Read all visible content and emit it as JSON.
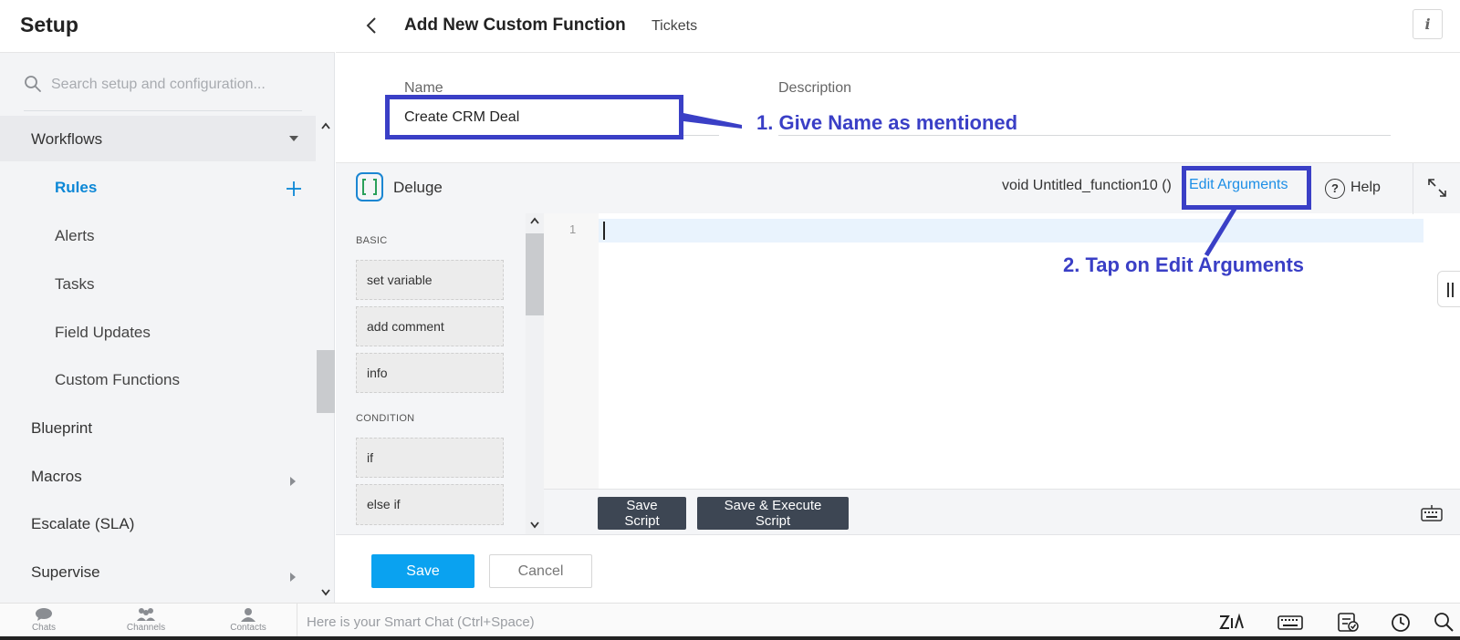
{
  "sidebar": {
    "title": "Setup",
    "search_placeholder": "Search setup and configuration...",
    "items": [
      {
        "label": "Workflows"
      },
      {
        "label": "Rules"
      },
      {
        "label": "Alerts"
      },
      {
        "label": "Tasks"
      },
      {
        "label": "Field Updates"
      },
      {
        "label": "Custom Functions"
      },
      {
        "label": "Blueprint"
      },
      {
        "label": "Macros"
      },
      {
        "label": "Escalate (SLA)"
      },
      {
        "label": "Supervise"
      }
    ]
  },
  "header": {
    "title": "Add New Custom Function",
    "subtitle": "Tickets",
    "info_label": "i"
  },
  "form": {
    "name_label": "Name",
    "name_value": "Create CRM Deal",
    "description_label": "Description"
  },
  "annotations": {
    "step1": "1. Give Name as mentioned",
    "step2": "2. Tap on Edit Arguments",
    "color": "#3a3fc6"
  },
  "editor": {
    "language_label": "Deluge",
    "function_signature": "void Untitled_function10 ()",
    "edit_arguments_label": "Edit Arguments",
    "help_label": "Help",
    "help_symbol": "?",
    "line_number": "1",
    "save_script_label": "Save Script",
    "save_execute_label": "Save & Execute Script"
  },
  "palette": {
    "categories": [
      {
        "label": "BASIC",
        "items": [
          "set variable",
          "add comment",
          "info"
        ]
      },
      {
        "label": "CONDITION",
        "items": [
          "if",
          "else if"
        ]
      }
    ]
  },
  "footer": {
    "save_label": "Save",
    "cancel_label": "Cancel"
  },
  "bottom_bar": {
    "chats_label": "Chats",
    "channels_label": "Channels",
    "contacts_label": "Contacts",
    "smart_chat_placeholder": "Here is your Smart Chat (Ctrl+Space)"
  },
  "colors": {
    "accent_blue": "#0aa2f0",
    "link_blue": "#1c8ee6",
    "dark_button": "#3d4653"
  }
}
